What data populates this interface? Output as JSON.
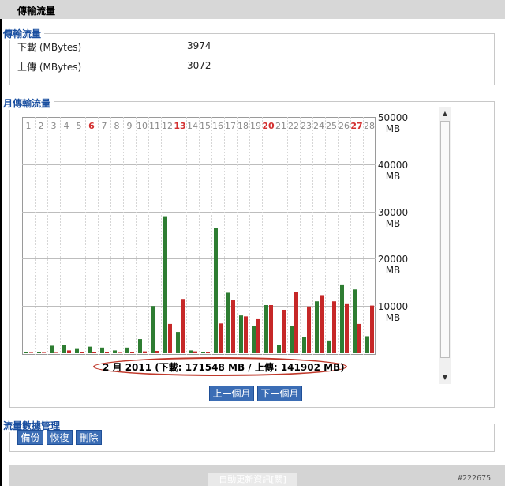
{
  "header": {
    "title": "傳輸流量"
  },
  "transfer": {
    "title": "傳輸流量",
    "rows": [
      {
        "label": "下載 (MBytes)",
        "value": "3974"
      },
      {
        "label": "上傳 (MBytes)",
        "value": "3072"
      }
    ]
  },
  "monthly": {
    "title": "月傳輸流量",
    "caption": "2 月 2011 (下載: 171548 MB / 上傳: 141902 MB)",
    "prev_label": "上一個月",
    "next_label": "下一個月"
  },
  "manage": {
    "title": "流量數據管理",
    "backup_label": "備份",
    "restore_label": "恢復",
    "delete_label": "刪除"
  },
  "footer": {
    "auto_refresh_label": "自動更新資訊[關]"
  },
  "watermark": "#222675",
  "colors": {
    "download": "#2e7d32",
    "upload": "#c62828",
    "weekend": "#d32f2f",
    "title": "#1a4fa0",
    "button": "#3b6db5"
  },
  "chart_data": {
    "type": "bar",
    "categories": [
      "1",
      "2",
      "3",
      "4",
      "5",
      "6",
      "7",
      "8",
      "9",
      "10",
      "11",
      "12",
      "13",
      "14",
      "15",
      "16",
      "17",
      "18",
      "19",
      "20",
      "21",
      "22",
      "23",
      "24",
      "25",
      "26",
      "27",
      "28"
    ],
    "highlighted_days": [
      "6",
      "13",
      "20",
      "27"
    ],
    "y_ticks": [
      "50000\nMB",
      "40000\nMB",
      "30000\nMB",
      "20000\nMB",
      "10000\nMB"
    ],
    "ylim": [
      0,
      50000
    ],
    "series": [
      {
        "values": [
          300,
          200,
          1600,
          1700,
          900,
          1400,
          1200,
          600,
          1200,
          3000,
          10000,
          29000,
          4500,
          600,
          200,
          26500,
          12800,
          8000,
          5800,
          10200,
          1700,
          5800,
          3400,
          11000,
          2700,
          14400,
          13500,
          3600
        ]
      },
      {
        "values": [
          100,
          100,
          100,
          600,
          300,
          300,
          200,
          100,
          300,
          400,
          500,
          6200,
          11500,
          400,
          200,
          6300,
          11200,
          7800,
          7200,
          10200,
          9200,
          12900,
          9900,
          12300,
          11000,
          10400,
          6200,
          10100
        ]
      }
    ]
  }
}
